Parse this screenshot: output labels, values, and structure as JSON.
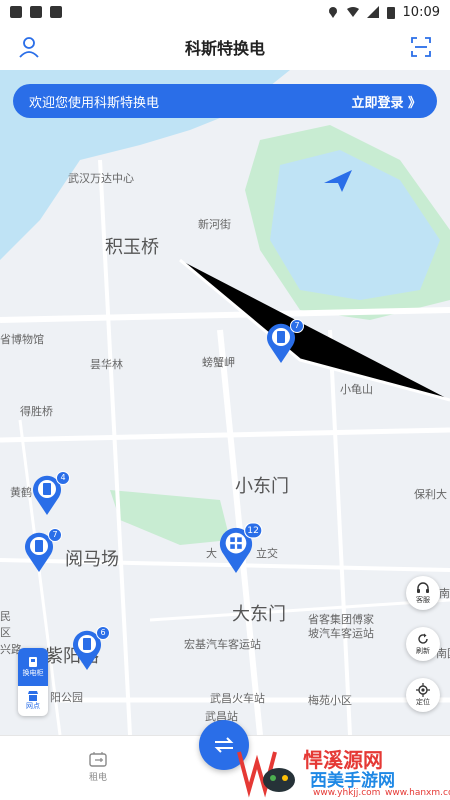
{
  "status_bar": {
    "time": "10:09"
  },
  "header": {
    "title": "科斯特换电"
  },
  "banner": {
    "welcome": "欢迎您使用科斯特换电",
    "login": "立即登录 》"
  },
  "map": {
    "labels": [
      {
        "text": "武汉万达中心",
        "size": "small"
      },
      {
        "text": "新河街",
        "size": "small"
      },
      {
        "text": "积玉桥",
        "size": "big"
      },
      {
        "text": "省博物馆",
        "size": "small"
      },
      {
        "text": "昙华林",
        "size": "small"
      },
      {
        "text": "螃蟹岬",
        "size": "small"
      },
      {
        "text": "小龟山",
        "size": "small"
      },
      {
        "text": "得胜桥",
        "size": "small"
      },
      {
        "text": "小东门",
        "size": "big"
      },
      {
        "text": "保利大",
        "size": "small"
      },
      {
        "text": "黄鹤",
        "size": "small"
      },
      {
        "text": "阅马场",
        "size": "big"
      },
      {
        "text": "大东门",
        "size": "big"
      },
      {
        "text": "省客集团傅家坡汽车客运站",
        "size": "small"
      },
      {
        "text": "宏基汽车客运站",
        "size": "small"
      },
      {
        "text": "民区",
        "size": "small"
      },
      {
        "text": "紫阳路",
        "size": "big"
      },
      {
        "text": "中南国",
        "size": "small"
      },
      {
        "text": "阳公园",
        "size": "small"
      },
      {
        "text": "武昌火车站",
        "size": "small"
      },
      {
        "text": "梅苑小区",
        "size": "small"
      },
      {
        "text": "武昌站",
        "size": "small"
      },
      {
        "text": "中南",
        "size": "small"
      },
      {
        "text": "大",
        "size": "small"
      },
      {
        "text": "立交",
        "size": "small"
      },
      {
        "text": "兴路",
        "size": "small"
      }
    ],
    "pins": [
      {
        "count": "7"
      },
      {
        "count": "4"
      },
      {
        "count": "7"
      },
      {
        "count": "12"
      },
      {
        "count": "6"
      }
    ]
  },
  "side_buttons": {
    "service": "客服",
    "refresh": "刷新",
    "locate": "定位"
  },
  "left_panel": {
    "cabinet": "换电柜",
    "outlet": "网点"
  },
  "tabbar": {
    "rent": "租电"
  },
  "watermark": {
    "brand": "悍溪源网",
    "site": "西美手游网",
    "url": "www.yhkjj.com",
    "url2": "www.hanxm.com"
  },
  "colors": {
    "accent": "#2a6ee8",
    "water": "#bfe3f5",
    "green": "#c8ecd2"
  }
}
